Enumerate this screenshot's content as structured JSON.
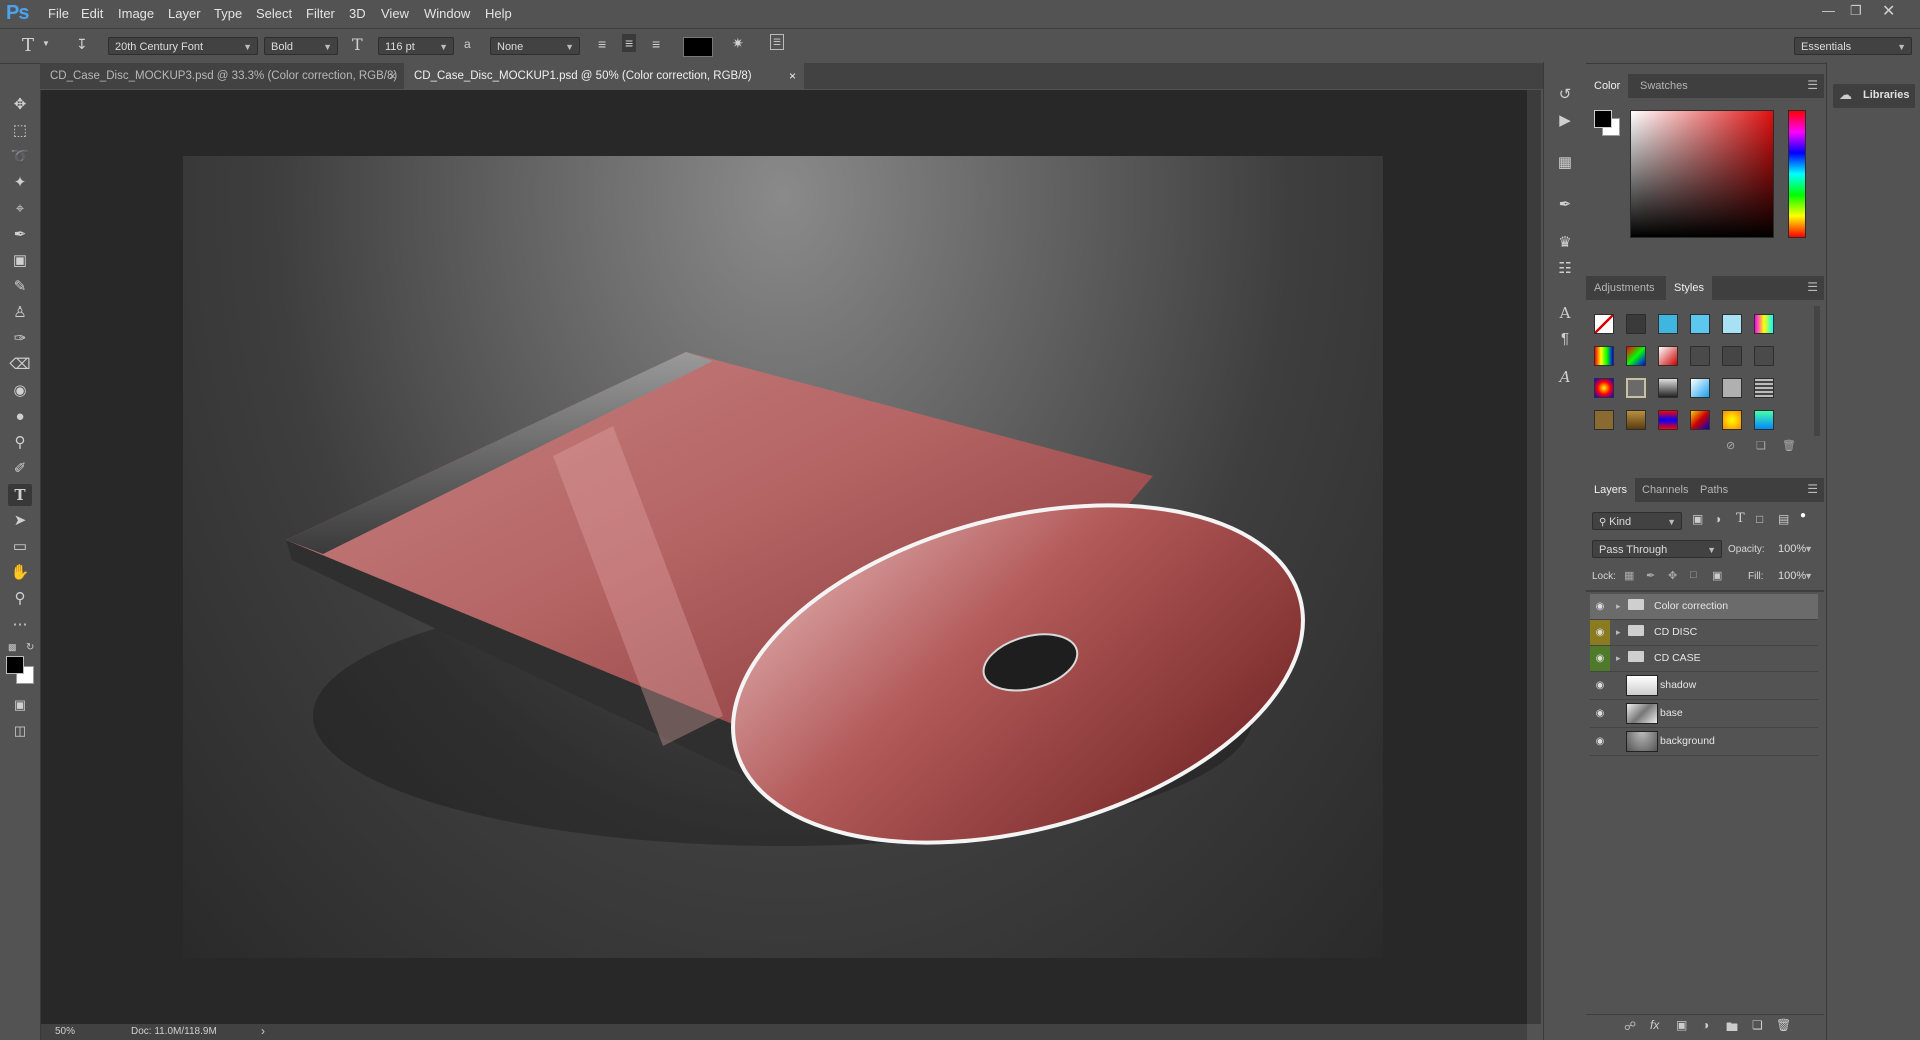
{
  "app": {
    "logo": "Ps"
  },
  "menu": [
    "File",
    "Edit",
    "Image",
    "Layer",
    "Type",
    "Select",
    "Filter",
    "3D",
    "View",
    "Window",
    "Help"
  ],
  "options": {
    "font_family": "20th Century Font",
    "font_style": "Bold",
    "font_size": "116 pt",
    "aa_label": "a",
    "anti_alias": "None",
    "workspace": "Essentials"
  },
  "tabs": [
    {
      "label": "CD_Case_Disc_MOCKUP3.psd @ 33.3% (Color correction, RGB/8)",
      "close": "×"
    },
    {
      "label": "CD_Case_Disc_MOCKUP1.psd @ 50% (Color correction, RGB/8)",
      "close": "×"
    }
  ],
  "status": {
    "zoom": "50%",
    "doc": "Doc: 11.0M/118.9M"
  },
  "color_panel": {
    "tabs": [
      "Color",
      "Swatches"
    ]
  },
  "styles_panel": {
    "tabs": [
      "Adjustments",
      "Styles"
    ]
  },
  "layers_panel": {
    "tabs": [
      "Layers",
      "Channels",
      "Paths"
    ],
    "filter_kind": "Kind",
    "blend_mode": "Pass Through",
    "opacity_label": "Opacity:",
    "opacity": "100%",
    "lock_label": "Lock:",
    "fill_label": "Fill:",
    "fill": "100%",
    "layers": [
      {
        "name": "Color correction",
        "type": "group",
        "eye_color": "none"
      },
      {
        "name": "CD DISC",
        "type": "group",
        "eye_color": "#8a7a20"
      },
      {
        "name": "CD CASE",
        "type": "group",
        "eye_color": "#4f7a2c"
      },
      {
        "name": "shadow",
        "type": "image",
        "eye_color": "none"
      },
      {
        "name": "base",
        "type": "image",
        "eye_color": "none"
      },
      {
        "name": "background",
        "type": "image",
        "eye_color": "none"
      }
    ]
  },
  "libraries": {
    "label": "Libraries"
  },
  "colors": {
    "accent": "#4aa3f0",
    "cd_red": "#a83c3c"
  }
}
